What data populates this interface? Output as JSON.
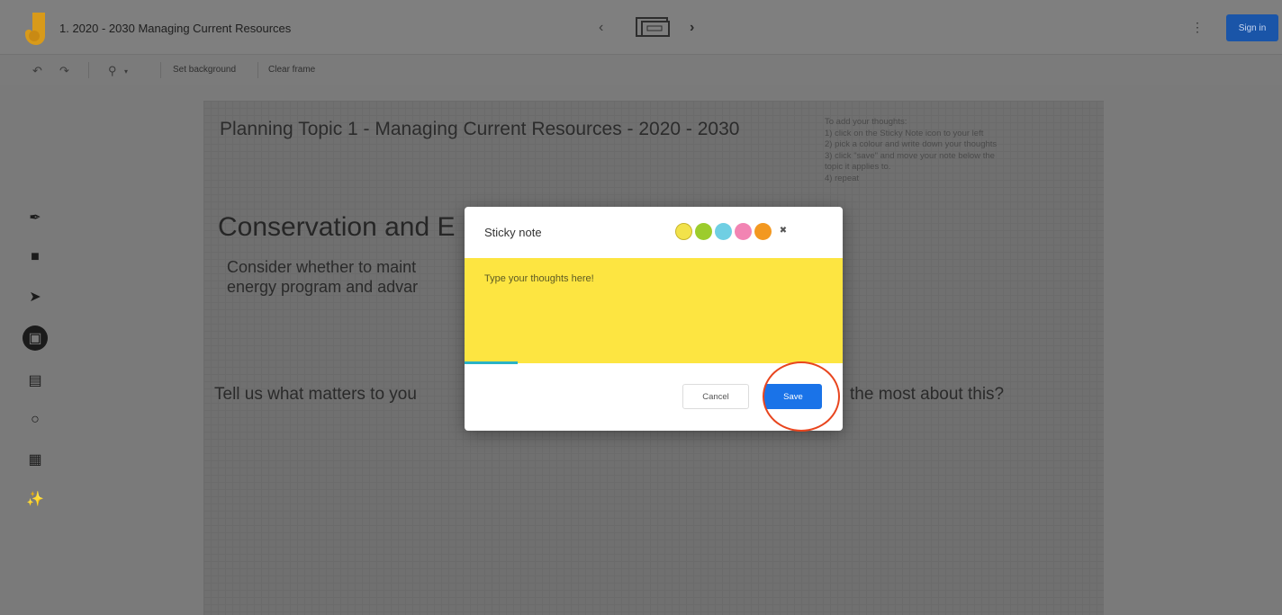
{
  "app": {
    "title": "1. 2020 - 2030 Managing Current Resources",
    "sign_in_label": "Sign in"
  },
  "toolbar": {
    "set_background_label": "Set background",
    "clear_frame_label": "Clear frame"
  },
  "canvas": {
    "title": "Planning Topic 1 - Managing Current Resources - 2020 - 2030",
    "instructions": [
      "To add your thoughts:",
      "1) click on the Sticky Note icon to your left",
      "2) pick a colour and write down your thoughts",
      "3) click \"save\" and move your note below the",
      "topic it applies to.",
      "4) repeat"
    ],
    "heading": "Conservation and E",
    "body_lines": [
      "Consider whether to maint",
      "energy program and advar"
    ],
    "question_left": "Tell us what matters to you",
    "question_right": "the most about this?"
  },
  "modal": {
    "title": "Sticky note",
    "placeholder": "Type your thoughts here!",
    "cancel_label": "Cancel",
    "save_label": "Save",
    "colors": [
      "#f2e24b",
      "#9ccc2c",
      "#6fcfe3",
      "#f284b3",
      "#f39820"
    ],
    "progress_fraction": 0.14
  },
  "theme": {
    "accent": "#1a73e8",
    "note_yellow": "#fde541",
    "highlight": "#e8451e"
  },
  "icons": {
    "logo": "jamboard-logo",
    "undo": "undo-icon",
    "redo": "redo-icon",
    "zoom": "zoom-icon",
    "pen": "pen-icon",
    "eraser": "eraser-icon",
    "select": "select-arrow-icon",
    "sticky_note": "sticky-note-icon",
    "image": "image-icon",
    "shape": "circle-shape-icon",
    "text_box": "text-box-icon",
    "laser": "laser-icon"
  }
}
